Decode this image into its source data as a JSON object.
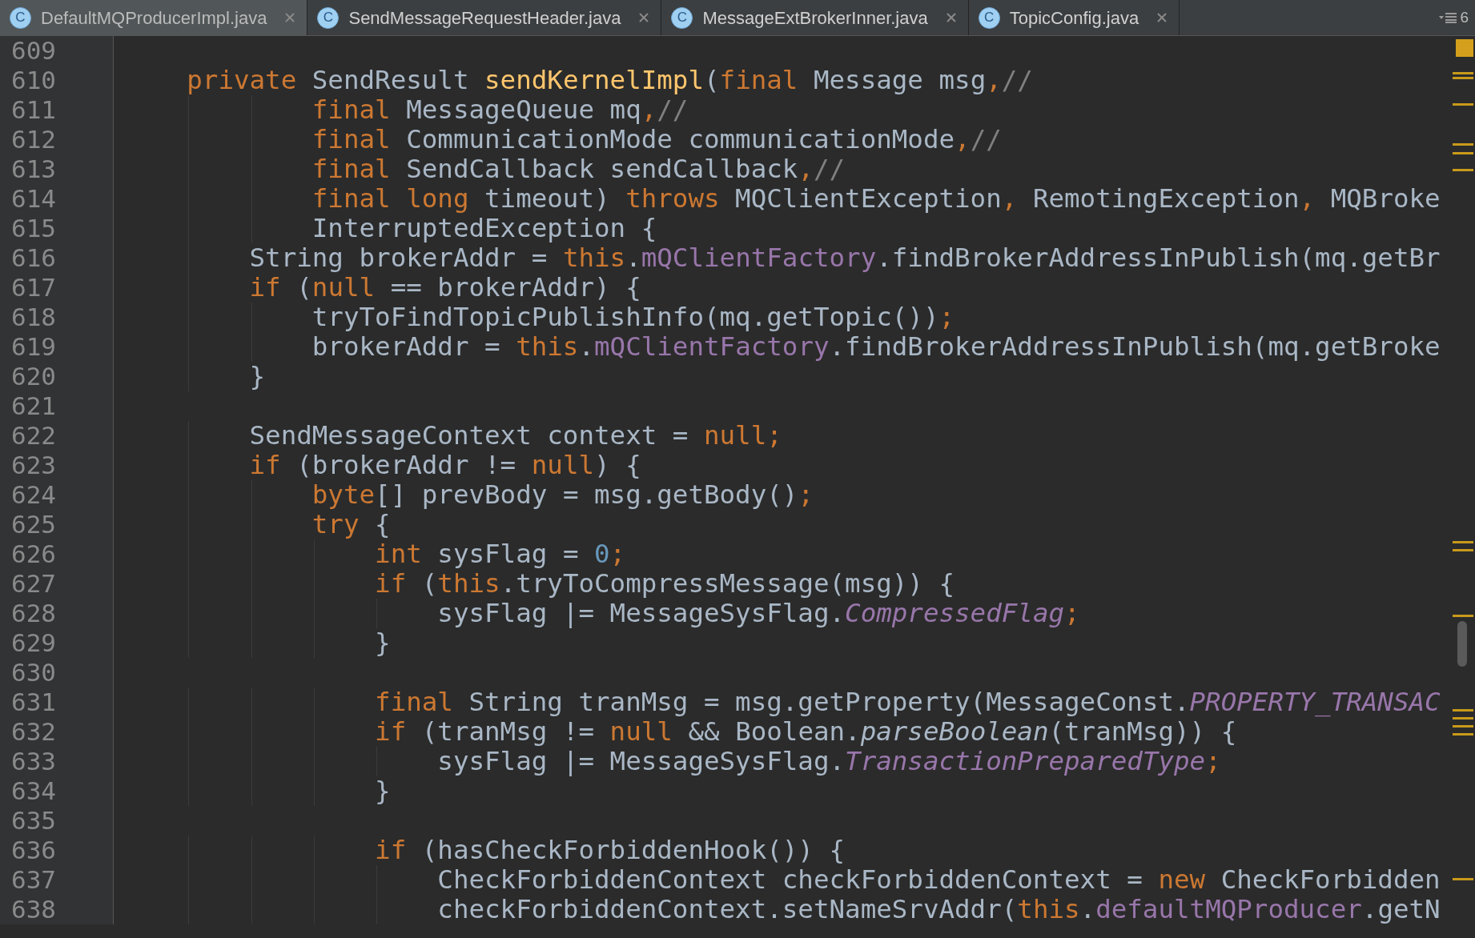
{
  "tabs": [
    {
      "icon_letter": "C",
      "label": "DefaultMQProducerImpl.java",
      "selected": true
    },
    {
      "icon_letter": "C",
      "label": "SendMessageRequestHeader.java",
      "selected": false
    },
    {
      "icon_letter": "C",
      "label": "MessageExtBrokerInner.java",
      "selected": false
    },
    {
      "icon_letter": "C",
      "label": "TopicConfig.java",
      "selected": false
    }
  ],
  "tab_overflow": {
    "count": "6"
  },
  "lines": [
    {
      "number": "609"
    },
    {
      "number": "610",
      "tokens": [
        {
          "kind": "keyword",
          "text": "    private"
        },
        {
          "kind": "plain",
          "text": " SendResult "
        },
        {
          "kind": "method",
          "text": "sendKernelImpl"
        },
        {
          "kind": "plain",
          "text": "("
        },
        {
          "kind": "keyword",
          "text": "final"
        },
        {
          "kind": "plain",
          "text": " Message msg"
        },
        {
          "kind": "keyword",
          "text": ","
        },
        {
          "kind": "comment",
          "text": "//"
        }
      ]
    },
    {
      "number": "611",
      "tokens": [
        {
          "kind": "keyword",
          "text": "            final"
        },
        {
          "kind": "plain",
          "text": " MessageQueue mq"
        },
        {
          "kind": "keyword",
          "text": ","
        },
        {
          "kind": "comment",
          "text": "//"
        }
      ]
    },
    {
      "number": "612",
      "tokens": [
        {
          "kind": "keyword",
          "text": "            final"
        },
        {
          "kind": "plain",
          "text": " CommunicationMode communicationMode"
        },
        {
          "kind": "keyword",
          "text": ","
        },
        {
          "kind": "comment",
          "text": "//"
        }
      ]
    },
    {
      "number": "613",
      "tokens": [
        {
          "kind": "keyword",
          "text": "            final"
        },
        {
          "kind": "plain",
          "text": " SendCallback sendCallback"
        },
        {
          "kind": "keyword",
          "text": ","
        },
        {
          "kind": "comment",
          "text": "//"
        }
      ]
    },
    {
      "number": "614",
      "tokens": [
        {
          "kind": "keyword",
          "text": "            final long"
        },
        {
          "kind": "plain",
          "text": " timeout) "
        },
        {
          "kind": "keyword",
          "text": "throws"
        },
        {
          "kind": "plain",
          "text": " MQClientException"
        },
        {
          "kind": "keyword",
          "text": ","
        },
        {
          "kind": "plain",
          "text": " RemotingException"
        },
        {
          "kind": "keyword",
          "text": ","
        },
        {
          "kind": "plain",
          "text": " MQBroke"
        }
      ]
    },
    {
      "number": "615",
      "tokens": [
        {
          "kind": "plain",
          "text": "            InterruptedException {"
        }
      ]
    },
    {
      "number": "616",
      "tokens": [
        {
          "kind": "plain",
          "text": "        String brokerAddr = "
        },
        {
          "kind": "keyword",
          "text": "this"
        },
        {
          "kind": "plain",
          "text": "."
        },
        {
          "kind": "field",
          "text": "mQClientFactory"
        },
        {
          "kind": "plain",
          "text": ".findBrokerAddressInPublish(mq.getBr"
        }
      ]
    },
    {
      "number": "617",
      "tokens": [
        {
          "kind": "keyword",
          "text": "        if"
        },
        {
          "kind": "plain",
          "text": " ("
        },
        {
          "kind": "keyword",
          "text": "null"
        },
        {
          "kind": "plain",
          "text": " == brokerAddr) {"
        }
      ]
    },
    {
      "number": "618",
      "tokens": [
        {
          "kind": "plain",
          "text": "            tryToFindTopicPublishInfo(mq.getTopic())"
        },
        {
          "kind": "keyword",
          "text": ";"
        }
      ]
    },
    {
      "number": "619",
      "tokens": [
        {
          "kind": "plain",
          "text": "            brokerAddr = "
        },
        {
          "kind": "keyword",
          "text": "this"
        },
        {
          "kind": "plain",
          "text": "."
        },
        {
          "kind": "field",
          "text": "mQClientFactory"
        },
        {
          "kind": "plain",
          "text": ".findBrokerAddressInPublish(mq.getBroke"
        }
      ]
    },
    {
      "number": "620",
      "tokens": [
        {
          "kind": "plain",
          "text": "        }"
        }
      ]
    },
    {
      "number": "621"
    },
    {
      "number": "622",
      "tokens": [
        {
          "kind": "plain",
          "text": "        SendMessageContext context = "
        },
        {
          "kind": "keyword",
          "text": "null;"
        }
      ]
    },
    {
      "number": "623",
      "tokens": [
        {
          "kind": "keyword",
          "text": "        if"
        },
        {
          "kind": "plain",
          "text": " (brokerAddr != "
        },
        {
          "kind": "keyword",
          "text": "null"
        },
        {
          "kind": "plain",
          "text": ") {"
        }
      ]
    },
    {
      "number": "624",
      "tokens": [
        {
          "kind": "keyword",
          "text": "            byte"
        },
        {
          "kind": "plain",
          "text": "[] prevBody = msg.getBody()"
        },
        {
          "kind": "keyword",
          "text": ";"
        }
      ]
    },
    {
      "number": "625",
      "tokens": [
        {
          "kind": "keyword",
          "text": "            try"
        },
        {
          "kind": "plain",
          "text": " {"
        }
      ]
    },
    {
      "number": "626",
      "tokens": [
        {
          "kind": "keyword",
          "text": "                int"
        },
        {
          "kind": "plain",
          "text": " sysFlag = "
        },
        {
          "kind": "number",
          "text": "0"
        },
        {
          "kind": "keyword",
          "text": ";"
        }
      ]
    },
    {
      "number": "627",
      "tokens": [
        {
          "kind": "keyword",
          "text": "                if"
        },
        {
          "kind": "plain",
          "text": " ("
        },
        {
          "kind": "keyword",
          "text": "this"
        },
        {
          "kind": "plain",
          "text": ".tryToCompressMessage(msg)) {"
        }
      ]
    },
    {
      "number": "628",
      "tokens": [
        {
          "kind": "plain",
          "text": "                    sysFlag |= MessageSysFlag."
        },
        {
          "kind": "static",
          "text": "CompressedFlag"
        },
        {
          "kind": "keyword",
          "text": ";"
        }
      ]
    },
    {
      "number": "629",
      "tokens": [
        {
          "kind": "plain",
          "text": "                }"
        }
      ]
    },
    {
      "number": "630"
    },
    {
      "number": "631",
      "tokens": [
        {
          "kind": "keyword",
          "text": "                final"
        },
        {
          "kind": "plain",
          "text": " String tranMsg = msg.getProperty(MessageConst."
        },
        {
          "kind": "static",
          "text": "PROPERTY_TRANSAC"
        }
      ]
    },
    {
      "number": "632",
      "tokens": [
        {
          "kind": "keyword",
          "text": "                if"
        },
        {
          "kind": "plain",
          "text": " (tranMsg != "
        },
        {
          "kind": "keyword",
          "text": "null"
        },
        {
          "kind": "plain",
          "text": " && Boolean."
        },
        {
          "kind": "italic",
          "text": "parseBoolean"
        },
        {
          "kind": "plain",
          "text": "(tranMsg)) {"
        }
      ]
    },
    {
      "number": "633",
      "tokens": [
        {
          "kind": "plain",
          "text": "                    sysFlag |= MessageSysFlag."
        },
        {
          "kind": "static",
          "text": "TransactionPreparedType"
        },
        {
          "kind": "keyword",
          "text": ";"
        }
      ]
    },
    {
      "number": "634",
      "tokens": [
        {
          "kind": "plain",
          "text": "                }"
        }
      ]
    },
    {
      "number": "635"
    },
    {
      "number": "636",
      "tokens": [
        {
          "kind": "keyword",
          "text": "                if"
        },
        {
          "kind": "plain",
          "text": " (hasCheckForbiddenHook()) {"
        }
      ]
    },
    {
      "number": "637",
      "tokens": [
        {
          "kind": "plain",
          "text": "                    CheckForbiddenContext checkForbiddenContext = "
        },
        {
          "kind": "keyword",
          "text": "new"
        },
        {
          "kind": "plain",
          "text": " CheckForbidden"
        }
      ]
    },
    {
      "number": "638",
      "tokens": [
        {
          "kind": "plain",
          "text": "                    checkForbiddenContext.setNameSrvAddr("
        },
        {
          "kind": "keyword",
          "text": "this"
        },
        {
          "kind": "plain",
          "text": "."
        },
        {
          "kind": "field",
          "text": "defaultMQProducer"
        },
        {
          "kind": "plain",
          "text": ".getN"
        }
      ]
    }
  ]
}
